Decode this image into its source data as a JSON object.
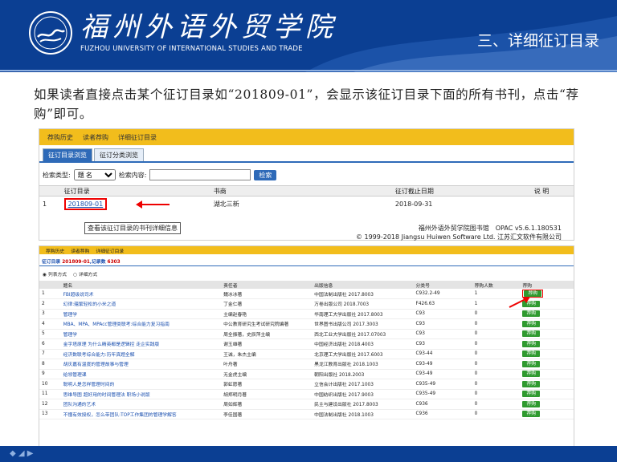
{
  "header": {
    "logo_cn": "福州外语外贸学院",
    "logo_en": "FUZHOU UNIVERSITY OF INTERNATIONAL STUDIES AND TRADE",
    "title": "三、详细征订目录"
  },
  "caption": "如果读者直接点击某个征订目录如“201809-01”，会显示该征订目录下面的所有书刊，点击“荐购”即可。",
  "screen1": {
    "nav": [
      "荐购历史",
      "读者荐购",
      "详细征订目录"
    ],
    "tabs": [
      "征订目录浏览",
      "征订分类浏览"
    ],
    "search_type_label": "检索类型:",
    "search_type_value": "题 名",
    "search_content_label": "检索内容:",
    "search_button": "检索",
    "columns": [
      "征订目录",
      "书商",
      "征订截止日期",
      "说 明"
    ],
    "row": {
      "index": "1",
      "catalog": "201809-01",
      "vendor": "湖北三新",
      "deadline": "2018-09-31",
      "note": ""
    },
    "tooltip": "查看该征订目录的书刊详细信息",
    "footer_line1": "福州外语外贸学院图书馆　OPAC v5.6.1.180531",
    "footer_line2": "© 1999-2018 Jiangsu Huiwen Software Ltd. 江苏汇文软件有限公司"
  },
  "screen2": {
    "nav": [
      "荐购历史",
      "读者荐购",
      "详细征订目录"
    ],
    "info_prefix": "征订目录",
    "info_catalog": "201809-01",
    "info_mid": ",记录数",
    "info_count": "6303",
    "radio1": "列表方式",
    "radio2": "详细方式",
    "columns": [
      "题名",
      "责任者",
      "出版信息",
      "分类号",
      "荐购人数",
      "荐购"
    ],
    "rows": [
      {
        "n": "1",
        "title": "FBI超级说司术",
        "author": "魏冰冰著",
        "pub": "中国法制出版社 2017.8003",
        "cls": "C932.2-49",
        "cnt": "1",
        "btn": "荐购"
      },
      {
        "n": "2",
        "title": "幻律:蕴繁轻松的小米之道",
        "author": "丁金仁著",
        "pub": "万卷出版公司 2018.7003",
        "cls": "F426.63",
        "cnt": "1",
        "btn": "荐购"
      },
      {
        "n": "3",
        "title": "管理学",
        "author": "主编赵春艳",
        "pub": "华南理工大学出版社 2017.8003",
        "cls": "C93",
        "cnt": "0",
        "btn": "荐购"
      },
      {
        "n": "4",
        "title": "MBA、MPA、MPAcc管理类联考:综合能力复习指南",
        "author": "中公教育研究生考试研究院编著",
        "pub": "世界图书出版公司 2017.3003",
        "cls": "C93",
        "cnt": "0",
        "btn": "荐购"
      },
      {
        "n": "5",
        "title": "管理学",
        "author": "周全振著，史辰萍主编",
        "pub": "西北工业大学出版社 2017.07003",
        "cls": "C93",
        "cnt": "0",
        "btn": "荐购"
      },
      {
        "n": "6",
        "title": "金字塔原理 为什么精英都是逻辑控 走企实践版",
        "author": "谢玉雄著",
        "pub": "中国经济出版社 2018.4003",
        "cls": "C93",
        "cnt": "0",
        "btn": "荐购"
      },
      {
        "n": "7",
        "title": "经济数联考综合能力:历年真题全解",
        "author": "王诚，朱杰主编",
        "pub": "北京理工大学出版社 2017.6003",
        "cls": "C93-44",
        "cnt": "0",
        "btn": "荐购"
      },
      {
        "n": "8",
        "title": "胡庆嘉有温度的管理故事与管理",
        "author": "叶舟著",
        "pub": "黑龙江教育出版社 2018.1003",
        "cls": "C93-49",
        "cnt": "0",
        "btn": "荐购"
      },
      {
        "n": "9",
        "title": "给领管理课",
        "author": "无金虎主编",
        "pub": "朝阳出版社 2018.2003",
        "cls": "C93-49",
        "cnt": "0",
        "btn": "荐购"
      },
      {
        "n": "10",
        "title": "聪明人是怎样管理时间的",
        "author": "郭虹愿著",
        "pub": "立信会计出版社 2017.1003",
        "cls": "C935-49",
        "cnt": "0",
        "btn": "荐购"
      },
      {
        "n": "11",
        "title": "思维导图 超好用的时间管理法 职场小说版",
        "author": "胡郑明月著",
        "pub": "中国纺织出版社 2017.9003",
        "cls": "C935-49",
        "cnt": "0",
        "btn": "荐购"
      },
      {
        "n": "12",
        "title": "团队沟通的艺术",
        "author": "周如辉著",
        "pub": "民主与建设出版社 2017.8003",
        "cls": "C936",
        "cnt": "0",
        "btn": "荐购"
      },
      {
        "n": "13",
        "title": "不懂有效授权，怎么带团队:TOP工作集团的管理学解答",
        "author": "李佳国著",
        "pub": "中国法制出版社 2018.1003",
        "cls": "C936",
        "cnt": "0",
        "btn": "荐购"
      }
    ]
  }
}
